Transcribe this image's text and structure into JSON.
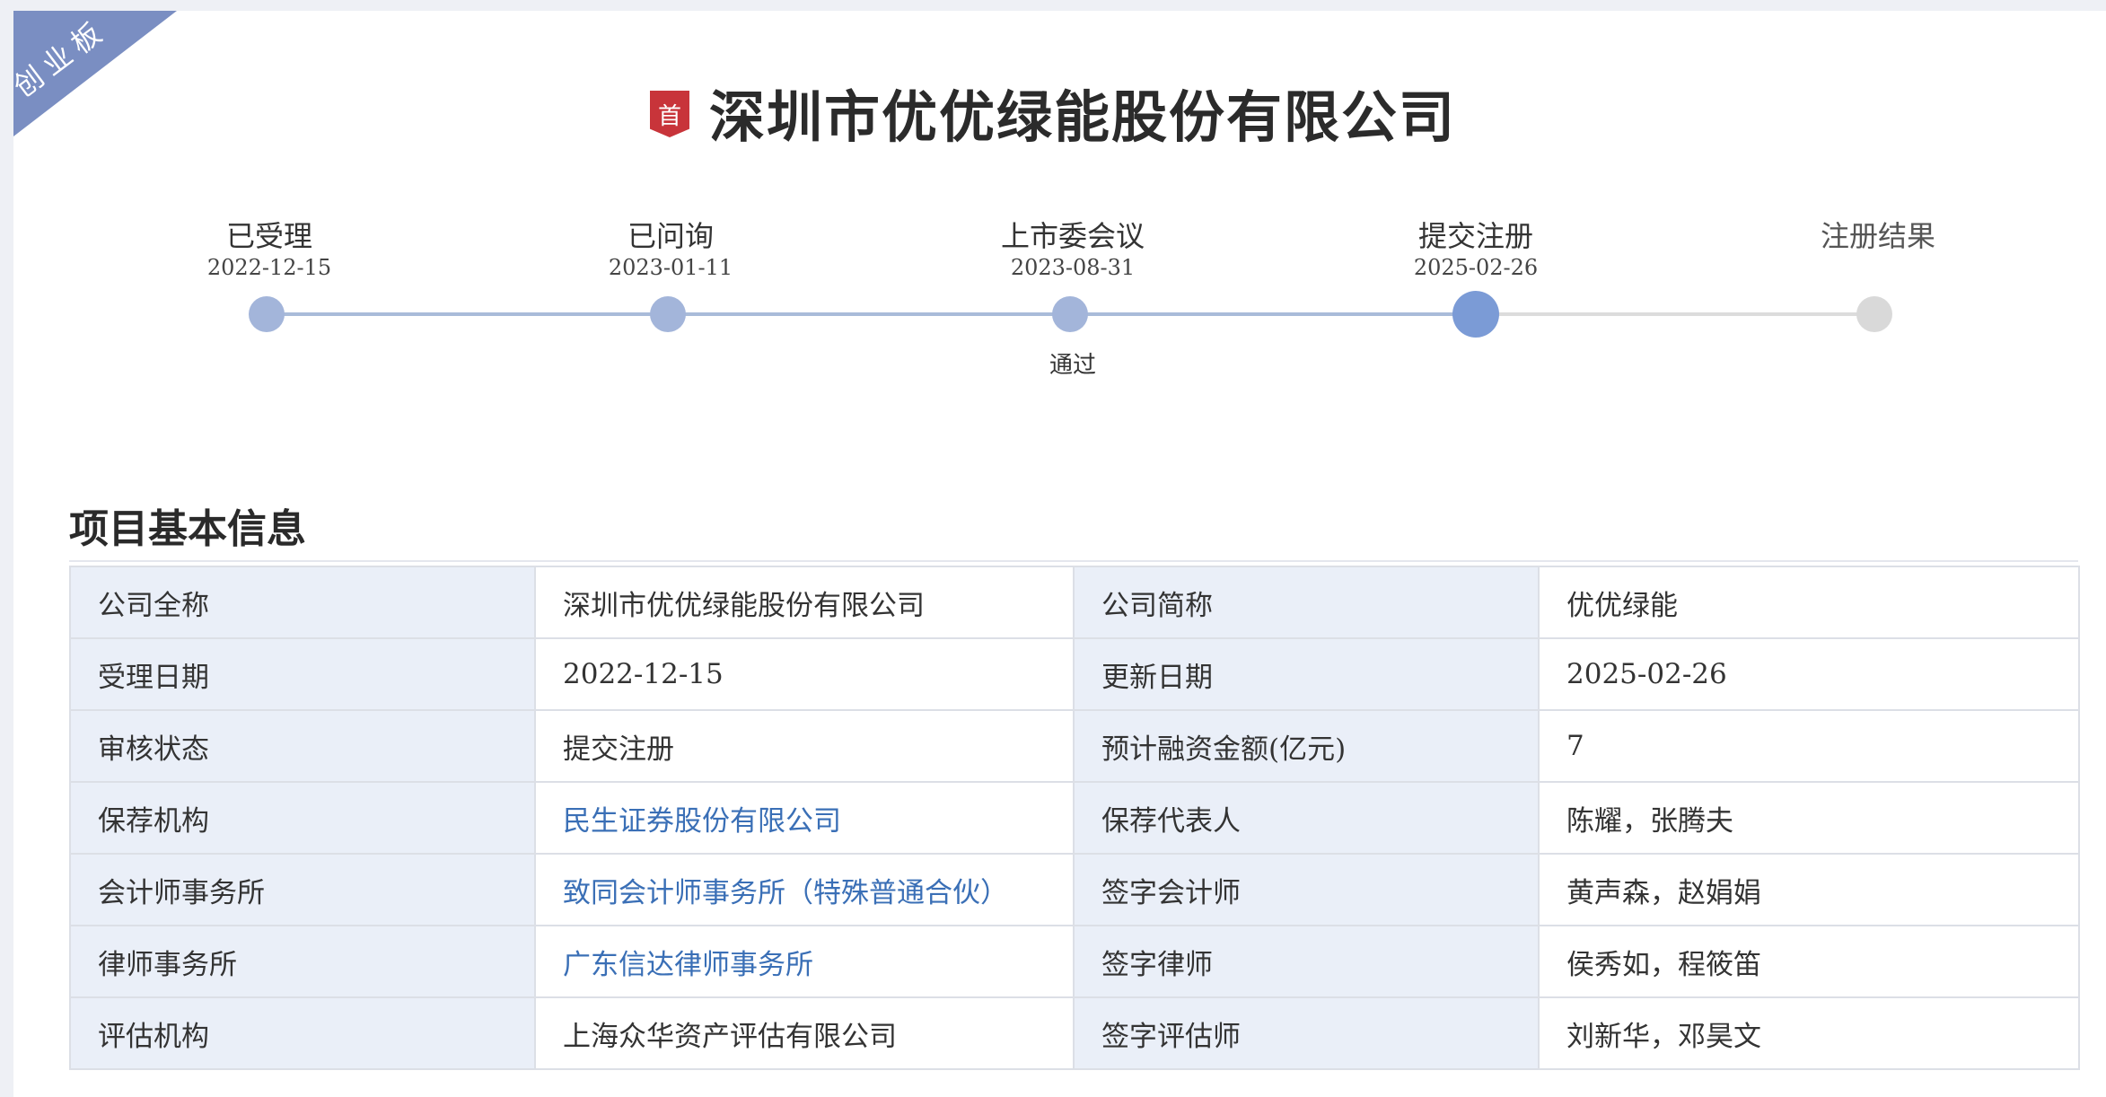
{
  "board_ribbon": "创业板",
  "first_badge": "首",
  "company_title": "深圳市优优绿能股份有限公司",
  "colors": {
    "ribbon": "#7a8ec2",
    "badge": "#c8343a",
    "link": "#3a6fb6",
    "dot_done": "#a3b5da",
    "dot_current": "#7b9bd6",
    "dot_pending": "#d9d9d9",
    "track_done": "#a9bbd9",
    "track_pending": "#dcdcdc",
    "label_bg": "#eaeff8"
  },
  "progress": {
    "steps": [
      {
        "label": "已受理",
        "date": "2022-12-15",
        "note": "",
        "status": "done"
      },
      {
        "label": "已问询",
        "date": "2023-01-11",
        "note": "",
        "status": "done"
      },
      {
        "label": "上市委会议",
        "date": "2023-08-31",
        "note": "通过",
        "status": "done"
      },
      {
        "label": "提交注册",
        "date": "2025-02-26",
        "note": "",
        "status": "current"
      },
      {
        "label": "注册结果",
        "date": "",
        "note": "",
        "status": "pending"
      }
    ]
  },
  "section": {
    "title": "项目基本信息"
  },
  "info_rows": [
    {
      "label1": "公司全称",
      "value1": "深圳市优优绿能股份有限公司",
      "label2": "公司简称",
      "value2": "优优绿能"
    },
    {
      "label1": "受理日期",
      "value1": "2022-12-15",
      "label2": "更新日期",
      "value2": "2025-02-26"
    },
    {
      "label1": "审核状态",
      "value1": "提交注册",
      "label2": "预计融资金额(亿元)",
      "value2": "7"
    },
    {
      "label1": "保荐机构",
      "value1": "民生证券股份有限公司",
      "label2": "保荐代表人",
      "value2": "陈耀，张腾夫"
    },
    {
      "label1": "会计师事务所",
      "value1": "致同会计师事务所（特殊普通合伙）",
      "label2": "签字会计师",
      "value2": "黄声森，赵娟娟"
    },
    {
      "label1": "律师事务所",
      "value1": "广东信达律师事务所",
      "label2": "签字律师",
      "value2": "侯秀如，程筱笛"
    },
    {
      "label1": "评估机构",
      "value1": "上海众华资产评估有限公司",
      "label2": "签字评估师",
      "value2": "刘新华，邓昊文"
    }
  ]
}
